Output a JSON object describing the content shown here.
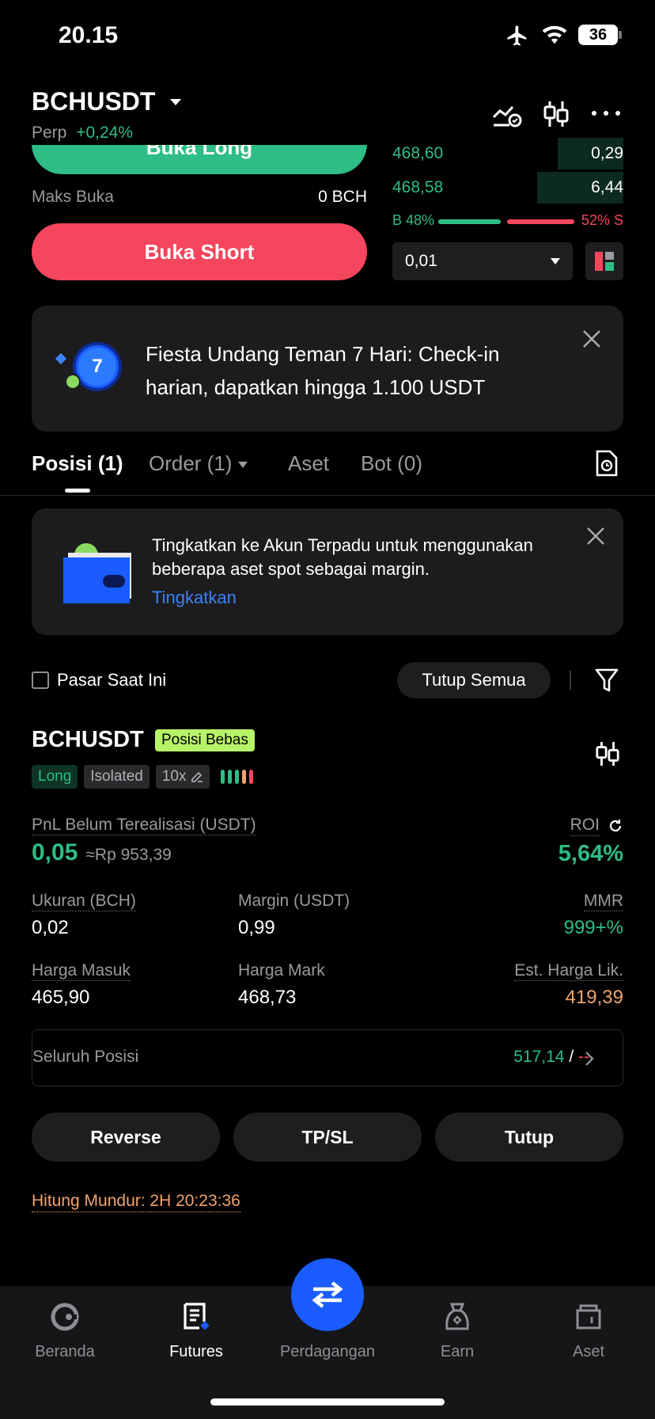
{
  "status_bar": {
    "time": "20.15",
    "battery": "36"
  },
  "header": {
    "symbol": "BCHUSDT",
    "type": "Perp",
    "change": "+0,24%"
  },
  "trade": {
    "buy_label": "Buka Long",
    "max_open_label": "Maks Buka",
    "max_open_value": "0 BCH",
    "sell_label": "Buka Short"
  },
  "orderbook": {
    "rows": [
      {
        "price": "468,60",
        "qty": "0,29",
        "depth": 0.13
      },
      {
        "price": "468,58",
        "qty": "6,44",
        "depth": 0.17
      }
    ],
    "buy_pct_label": "B 48%",
    "sell_pct_label": "52% S",
    "buy_pct": 48,
    "precision": "0,01"
  },
  "promo": {
    "badge": "7",
    "text": "Fiesta Undang Teman 7 Hari: Check-in harian, dapatkan hingga 1.100 USDT"
  },
  "tabs": [
    {
      "label": "Posisi (1)"
    },
    {
      "label": "Order (1)"
    },
    {
      "label": "Aset"
    },
    {
      "label": "Bot (0)"
    }
  ],
  "upgrade": {
    "text": "Tingkatkan ke Akun Terpadu untuk menggunakan beberapa aset spot sebagai margin.",
    "link": "Tingkatkan"
  },
  "filters": {
    "checkbox_label": "Pasar Saat Ini",
    "close_all": "Tutup Semua"
  },
  "position": {
    "symbol": "BCHUSDT",
    "badge": "Posisi Bebas",
    "side": "Long",
    "margin_mode": "Isolated",
    "leverage": "10x",
    "pnl_label": "PnL Belum Terealisasi (USDT)",
    "pnl_value": "0,05",
    "pnl_idr": "≈Rp 953,39",
    "roi_label": "ROI",
    "roi_value": "5,64%",
    "size_label": "Ukuran (BCH)",
    "size_value": "0,02",
    "margin_label": "Margin (USDT)",
    "margin_value": "0,99",
    "mmr_label": "MMR",
    "mmr_value": "999+%",
    "entry_label": "Harga Masuk",
    "entry_value": "465,90",
    "mark_label": "Harga Mark",
    "mark_value": "468,73",
    "liq_label": "Est. Harga Lik.",
    "liq_value": "419,39",
    "full_label": "Seluruh Posisi",
    "full_value": "517,14",
    "full_sep": "/",
    "full_value2": "--",
    "btn_reverse": "Reverse",
    "btn_tpsl": "TP/SL",
    "btn_close": "Tutup",
    "countdown": "Hitung Mundur: 2H 20:23:36"
  },
  "nav": [
    {
      "label": "Beranda"
    },
    {
      "label": "Futures"
    },
    {
      "label": "Perdagangan"
    },
    {
      "label": "Earn"
    },
    {
      "label": "Aset"
    }
  ],
  "colors": {
    "green": "#2ebd85",
    "red": "#f6465d",
    "orange": "#f0a36b",
    "blue": "#1a5cff",
    "link": "#3d82f7"
  }
}
